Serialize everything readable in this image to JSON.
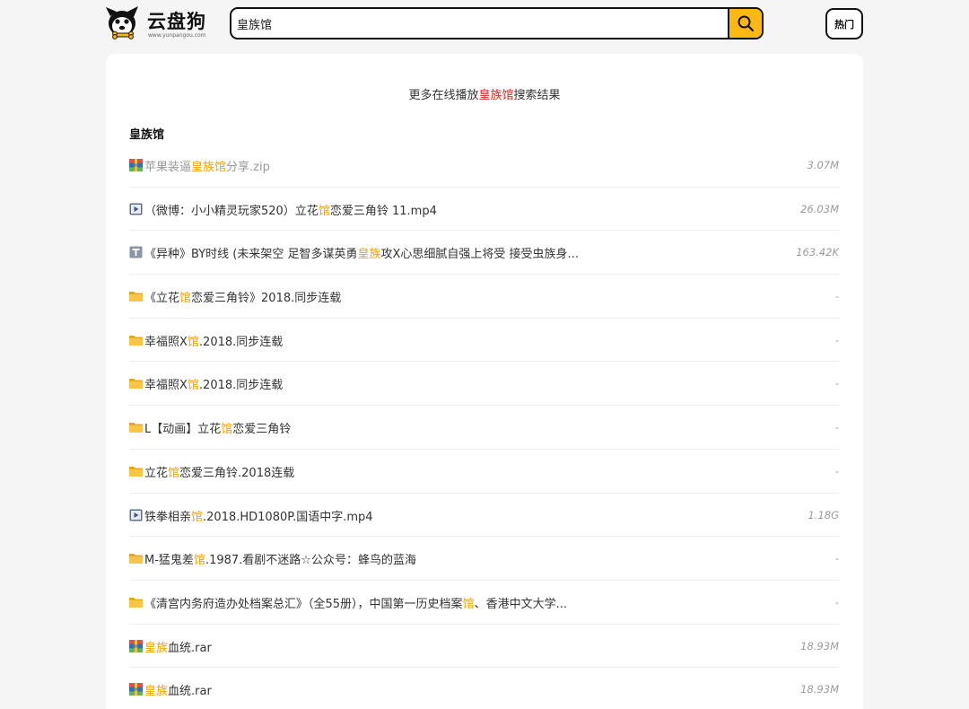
{
  "header": {
    "logo_text": "云盘狗",
    "logo_subtext": "www.yunpangou.com",
    "search_value": "皇族馆",
    "hot_label": "热门",
    "accent": "#fdb813"
  },
  "main": {
    "more_prefix": "更多在线播放",
    "more_keyword": "皇族馆",
    "more_suffix": "搜索结果",
    "section_title": "皇族馆",
    "results": [
      {
        "type": "archive",
        "dim": true,
        "parts": [
          {
            "t": "苹果装逼"
          },
          {
            "t": "皇族馆",
            "hl": true
          },
          {
            "t": "分享.zip"
          }
        ],
        "size": "3.07M"
      },
      {
        "type": "video",
        "dim": false,
        "parts": [
          {
            "t": "（微博：小小精灵玩家520）立花"
          },
          {
            "t": "馆",
            "hl": true
          },
          {
            "t": "恋爱三角铃 11.mp4"
          }
        ],
        "size": "26.03M"
      },
      {
        "type": "text",
        "dim": false,
        "parts": [
          {
            "t": "《异种》BY时线 (未来架空 足智多谋英勇"
          },
          {
            "t": "皇族",
            "hl": true
          },
          {
            "t": "攻X心思细腻自强上将受 接受虫族身..."
          }
        ],
        "size": "163.42K"
      },
      {
        "type": "folder",
        "dim": false,
        "parts": [
          {
            "t": "《立花"
          },
          {
            "t": "馆",
            "hl": true
          },
          {
            "t": "恋爱三角铃》2018.同步连载"
          }
        ],
        "size": "-"
      },
      {
        "type": "folder",
        "dim": false,
        "parts": [
          {
            "t": "幸福照X"
          },
          {
            "t": "馆",
            "hl": true
          },
          {
            "t": ".2018.同步连载"
          }
        ],
        "size": "-"
      },
      {
        "type": "folder",
        "dim": false,
        "parts": [
          {
            "t": "幸福照X"
          },
          {
            "t": "馆",
            "hl": true
          },
          {
            "t": ".2018.同步连载"
          }
        ],
        "size": "-"
      },
      {
        "type": "folder",
        "dim": false,
        "parts": [
          {
            "t": "L【动画】立花"
          },
          {
            "t": "馆",
            "hl": true
          },
          {
            "t": "恋爱三角铃"
          }
        ],
        "size": "-"
      },
      {
        "type": "folder",
        "dim": false,
        "parts": [
          {
            "t": "立花"
          },
          {
            "t": "馆",
            "hl": true
          },
          {
            "t": "恋爱三角铃.2018连载"
          }
        ],
        "size": "-"
      },
      {
        "type": "video",
        "dim": false,
        "parts": [
          {
            "t": "铁拳相亲"
          },
          {
            "t": "馆",
            "hl": true
          },
          {
            "t": ".2018.HD1080P.国语中字.mp4"
          }
        ],
        "size": "1.18G"
      },
      {
        "type": "folder",
        "dim": false,
        "parts": [
          {
            "t": "M-猛鬼差"
          },
          {
            "t": "馆",
            "hl": true
          },
          {
            "t": ".1987.看剧不迷路☆公众号：蜂鸟的蓝海"
          }
        ],
        "size": "-"
      },
      {
        "type": "folder",
        "dim": false,
        "parts": [
          {
            "t": "《清宫内务府造办处档案总汇》（全55册），中国第一历史档案"
          },
          {
            "t": "馆",
            "hl": true
          },
          {
            "t": "、香港中文大学..."
          }
        ],
        "size": "-"
      },
      {
        "type": "archive",
        "dim": false,
        "parts": [
          {
            "t": "皇族",
            "hl": true
          },
          {
            "t": "血统.rar"
          }
        ],
        "size": "18.93M"
      },
      {
        "type": "archive",
        "dim": false,
        "parts": [
          {
            "t": "皇族",
            "hl": true
          },
          {
            "t": "血统.rar"
          }
        ],
        "size": "18.93M"
      }
    ]
  }
}
